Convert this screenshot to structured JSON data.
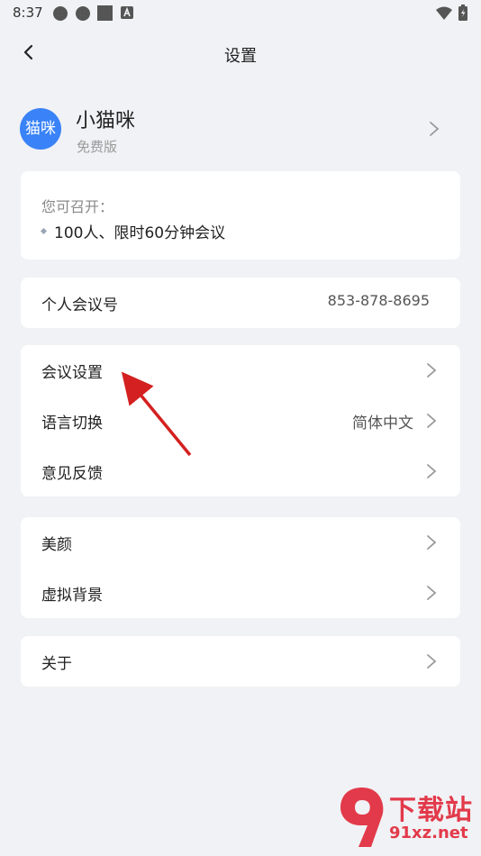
{
  "status_bar": {
    "time": "8:37"
  },
  "header": {
    "title": "设置"
  },
  "profile": {
    "avatar_text": "猫咪",
    "name": "小猫咪",
    "plan": "免费版"
  },
  "capacity": {
    "heading": "您可召开：",
    "item": "100人、限时60分钟会议"
  },
  "meeting_id": {
    "label": "个人会议号",
    "value": "853-878-8695"
  },
  "settings_group": {
    "meeting_settings": "会议设置",
    "language": "语言切换",
    "language_value": "简体中文",
    "feedback": "意见反馈"
  },
  "beauty_group": {
    "beauty": "美颜",
    "virtual_bg": "虚拟背景"
  },
  "about": {
    "label": "关于"
  },
  "watermark": {
    "line1": "下载站",
    "line2": "91xz.net"
  },
  "colors": {
    "accent": "#3a82f7",
    "background": "#f1f2f5",
    "arrow": "#d42020",
    "watermark": "#e23a4a"
  }
}
